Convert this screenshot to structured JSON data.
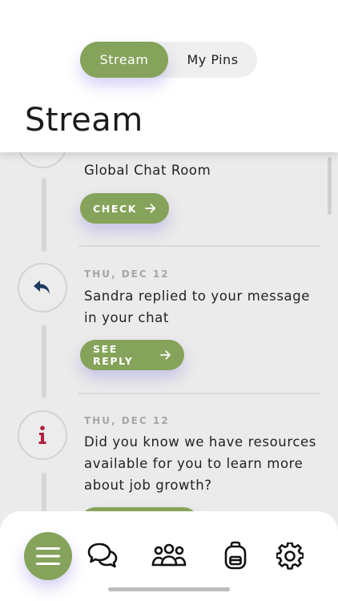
{
  "header": {
    "tabs": [
      {
        "label": "Stream",
        "active": true
      },
      {
        "label": "My Pins",
        "active": false
      }
    ],
    "title": "Stream"
  },
  "stream": {
    "items": [
      {
        "date": "",
        "message_partial": "Global Chat Room",
        "button_label": "CHECK",
        "icon": "unknown-icon"
      },
      {
        "date": "THU, DEC 12",
        "message": "Sandra replied to your message in your chat",
        "button_label": "SEE REPLY",
        "icon": "reply-icon"
      },
      {
        "date": "THU, DEC 12",
        "message": "Did you know we have resources available for you to learn more about job growth?",
        "icon": "info-icon"
      }
    ]
  },
  "tabbar": {
    "items": [
      "menu-icon",
      "chat-icon",
      "group-icon",
      "backpack-icon",
      "gear-icon"
    ]
  },
  "colors": {
    "accent": "#85a35a",
    "reply_icon": "#1f3a5f",
    "info_icon": "#b0213a"
  }
}
